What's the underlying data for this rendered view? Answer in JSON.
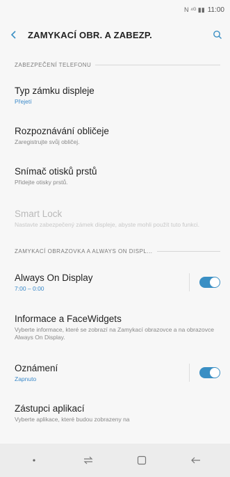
{
  "status_bar": {
    "icons_text": "N ⁴ᴳ ▮▮",
    "time": "11:00"
  },
  "app_bar": {
    "title": "ZAMYKACÍ OBR. A ZABEZP."
  },
  "sections": [
    {
      "header": "ZABEZPEČENÍ TELEFONU",
      "items": [
        {
          "title": "Typ zámku displeje",
          "subtitle": "Přejetí"
        },
        {
          "title": "Rozpoznávání obličeje",
          "subtitle": "Zaregistrujte svůj obličej."
        },
        {
          "title": "Snímač otisků prstů",
          "subtitle": "Přidejte otisky prstů."
        },
        {
          "title": "Smart Lock",
          "subtitle": "Nastavte zabezpečený zámek displeje, abyste mohli použít tuto funkci."
        }
      ]
    },
    {
      "header": "ZAMYKACÍ OBRAZOVKA A ALWAYS ON DISPL...",
      "items": [
        {
          "title": "Always On Display",
          "subtitle": "7:00 – 0:00",
          "toggle": true
        },
        {
          "title": "Informace a FaceWidgets",
          "subtitle": "Vyberte informace, které se zobrazí na Zamykací obrazovce a na obrazovce Always On Display."
        },
        {
          "title": "Oznámení",
          "subtitle": "Zapnuto",
          "toggle": true
        },
        {
          "title": "Zástupci aplikací",
          "subtitle": "Vyberte aplikace, které budou zobrazeny na"
        }
      ]
    }
  ],
  "colors": {
    "accent": "#3a8fc4",
    "background": "#f7f7f7"
  }
}
